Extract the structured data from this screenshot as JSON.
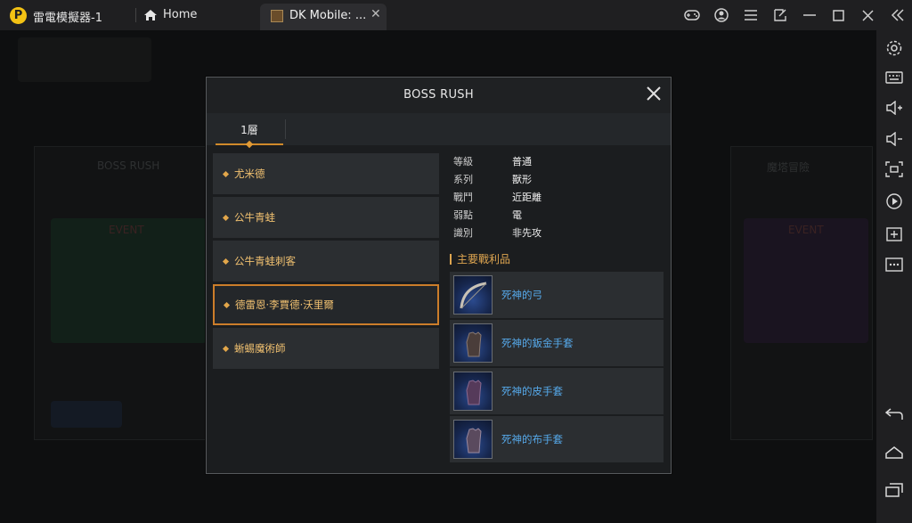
{
  "titlebar": {
    "app_title": "雷電模擬器-1",
    "home_label": "Home",
    "tab_label": "DK Mobile: ...",
    "logo_letter": "P"
  },
  "dialog": {
    "title": "BOSS RUSH",
    "floor_tab": "1層",
    "bosses": [
      {
        "name": "尤米德",
        "selected": false
      },
      {
        "name": "公牛青蛙",
        "selected": false
      },
      {
        "name": "公牛青蛙刺客",
        "selected": false
      },
      {
        "name": "德雷恩·李賈德·沃里爾",
        "selected": true
      },
      {
        "name": "蜥蜴魔術師",
        "selected": false
      }
    ],
    "info": [
      {
        "key": "等級",
        "value": "普通"
      },
      {
        "key": "系列",
        "value": "獸形"
      },
      {
        "key": "戰鬥",
        "value": "近距離"
      },
      {
        "key": "弱點",
        "value": "電"
      },
      {
        "key": "識別",
        "value": "非先攻"
      }
    ],
    "loot_heading": "主要戰利品",
    "loot": [
      {
        "name": "死神的弓",
        "icon": "bow-icon"
      },
      {
        "name": "死神的鈑金手套",
        "icon": "plate-gauntlet-icon"
      },
      {
        "name": "死神的皮手套",
        "icon": "leather-glove-icon"
      },
      {
        "name": "死神的布手套",
        "icon": "cloth-glove-icon"
      }
    ]
  },
  "background": {
    "left_card_title": "BOSS RUSH",
    "right_card_title": "魔塔冒險",
    "event_label": "EVENT"
  }
}
